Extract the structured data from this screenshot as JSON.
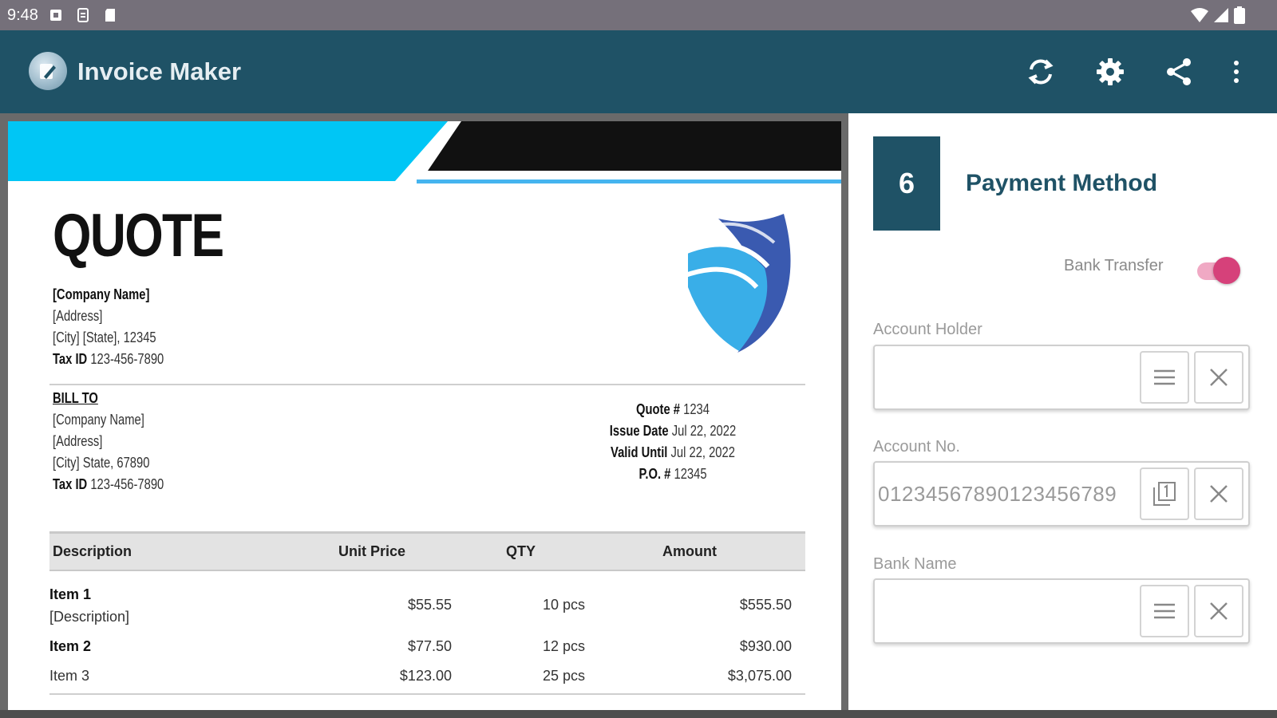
{
  "status_bar": {
    "time": "9:48"
  },
  "app": {
    "title": "Invoice Maker"
  },
  "colors": {
    "primary": "#1f5266",
    "banner_cyan": "#00c6f5",
    "toggle_on": "#d6417a",
    "shield_dark": "#3a5ab0",
    "shield_light": "#39aee8"
  },
  "toolbar": {
    "icons": [
      "sync-icon",
      "gear-icon",
      "share-icon",
      "more-vert-icon"
    ]
  },
  "document": {
    "title": "QUOTE",
    "from": {
      "company": "[Company Name]",
      "address": "[Address]",
      "city": "[City] [State], 12345",
      "tax_label": "Tax ID",
      "tax_value": "123-456-7890"
    },
    "bill_to": {
      "heading": "BILL TO",
      "company": "[Company Name]",
      "address": "[Address]",
      "city": "[City] State, 67890",
      "tax_label": "Tax ID",
      "tax_value": "123-456-7890"
    },
    "meta": {
      "quote_label": "Quote #",
      "quote_value": "1234",
      "issue_label": "Issue Date",
      "issue_value": "Jul 22, 2022",
      "valid_label": "Valid Until",
      "valid_value": "Jul 22, 2022",
      "po_label": "P.O. #",
      "po_value": "12345"
    },
    "table": {
      "headers": [
        "Description",
        "Unit Price",
        "QTY",
        "Amount"
      ],
      "rows": [
        {
          "name": "Item 1",
          "desc": "[Description]",
          "price": "$55.55",
          "qty": "10 pcs",
          "amount": "$555.50"
        },
        {
          "name": "Item 2",
          "desc": "",
          "price": "$77.50",
          "qty": "12 pcs",
          "amount": "$930.00"
        },
        {
          "name": "Item 3",
          "desc": "",
          "price": "$123.00",
          "qty": "25 pcs",
          "amount": "$3,075.00"
        }
      ]
    }
  },
  "panel": {
    "step": "6",
    "title": "Payment Method",
    "toggle_label": "Bank Transfer",
    "toggle_on": true,
    "fields": [
      {
        "label": "Account Holder",
        "value": "",
        "button_icon": "list-icon"
      },
      {
        "label": "Account No.",
        "value": "01234567890123456789",
        "button_icon": "counter-icon"
      },
      {
        "label": "Bank Name",
        "value": "",
        "button_icon": "list-icon"
      }
    ]
  }
}
